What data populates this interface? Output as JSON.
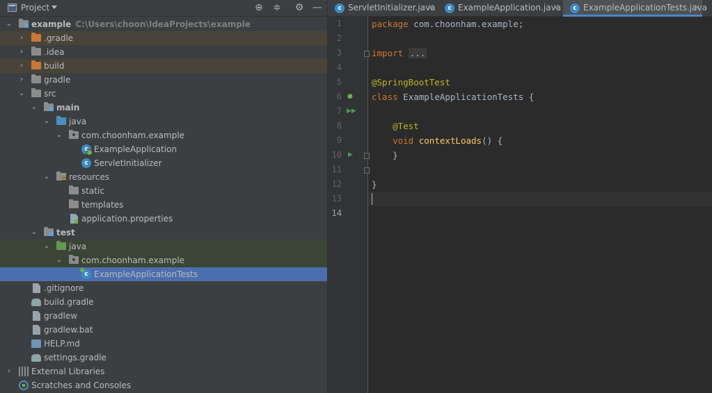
{
  "project_panel": {
    "title": "Project",
    "tree": [
      {
        "label": "example",
        "sub": "C:\\Users\\choon\\IdeaProjects\\example",
        "bold": true,
        "icon": "module-folder-icon"
      },
      {
        "label": ".gradle",
        "icon": "folder-excluded-icon"
      },
      {
        "label": ".idea",
        "icon": "folder-icon"
      },
      {
        "label": "build",
        "icon": "folder-excluded-icon"
      },
      {
        "label": "gradle",
        "icon": "folder-icon"
      },
      {
        "label": "src",
        "icon": "folder-icon"
      },
      {
        "label": "main",
        "bold": true,
        "icon": "source-root-folder-icon"
      },
      {
        "label": "java",
        "icon": "source-folder-icon"
      },
      {
        "label": "com.choonham.example",
        "icon": "package-icon"
      },
      {
        "label": "ExampleApplication",
        "icon": "spring-class-icon"
      },
      {
        "label": "ServletInitializer",
        "icon": "class-icon"
      },
      {
        "label": "resources",
        "icon": "resources-folder-icon"
      },
      {
        "label": "static",
        "icon": "folder-icon"
      },
      {
        "label": "templates",
        "icon": "folder-icon"
      },
      {
        "label": "application.properties",
        "icon": "properties-file-icon"
      },
      {
        "label": "test",
        "bold": true,
        "icon": "test-root-folder-icon"
      },
      {
        "label": "java",
        "icon": "test-source-folder-icon"
      },
      {
        "label": "com.choonham.example",
        "icon": "package-icon"
      },
      {
        "label": "ExampleApplicationTests",
        "icon": "test-class-icon"
      },
      {
        "label": ".gitignore",
        "icon": "gitignore-file-icon"
      },
      {
        "label": "build.gradle",
        "icon": "gradle-file-icon"
      },
      {
        "label": "gradlew",
        "icon": "file-icon"
      },
      {
        "label": "gradlew.bat",
        "icon": "file-icon"
      },
      {
        "label": "HELP.md",
        "icon": "markdown-file-icon"
      },
      {
        "label": "settings.gradle",
        "icon": "gradle-file-icon"
      },
      {
        "label": "External Libraries",
        "icon": "libraries-icon"
      },
      {
        "label": "Scratches and Consoles",
        "icon": "scratches-icon"
      }
    ]
  },
  "tabs": [
    {
      "label": "ServletInitializer.java",
      "close": "×",
      "icon_letter": "c"
    },
    {
      "label": "ExampleApplication.java",
      "close": "×",
      "icon_letter": "c"
    },
    {
      "label": "ExampleApplicationTests.java",
      "close": "×",
      "icon_letter": "c",
      "active": true
    }
  ],
  "editor": {
    "line_numbers": [
      "1",
      "2",
      "3",
      "4",
      "5",
      "6",
      "7",
      "8",
      "9",
      "10",
      "11",
      "12",
      "13",
      "14"
    ],
    "code": {
      "l1_kw": "package",
      "l1_rest": " com.choonham.example;",
      "l3_kw": "import",
      "l3_fold": "...",
      "l6_ann": "@SpringBootTest",
      "l7_kw": "class",
      "l7_rest": " ExampleApplicationTests {",
      "l9_ann": "@Test",
      "l10_kw": "void",
      "l10_fn": "contextLoads",
      "l10_rest": "() {",
      "l11": "}",
      "l13": "}"
    }
  },
  "colors": {
    "panel_bg": "#3c3f41",
    "editor_bg": "#2b2b2b",
    "selection": "#4b6eaf",
    "excluded_row": "#49443a",
    "test_row": "#3b4536",
    "keyword": "#cc7832",
    "annotation": "#bbb529",
    "function": "#ffc66d"
  }
}
